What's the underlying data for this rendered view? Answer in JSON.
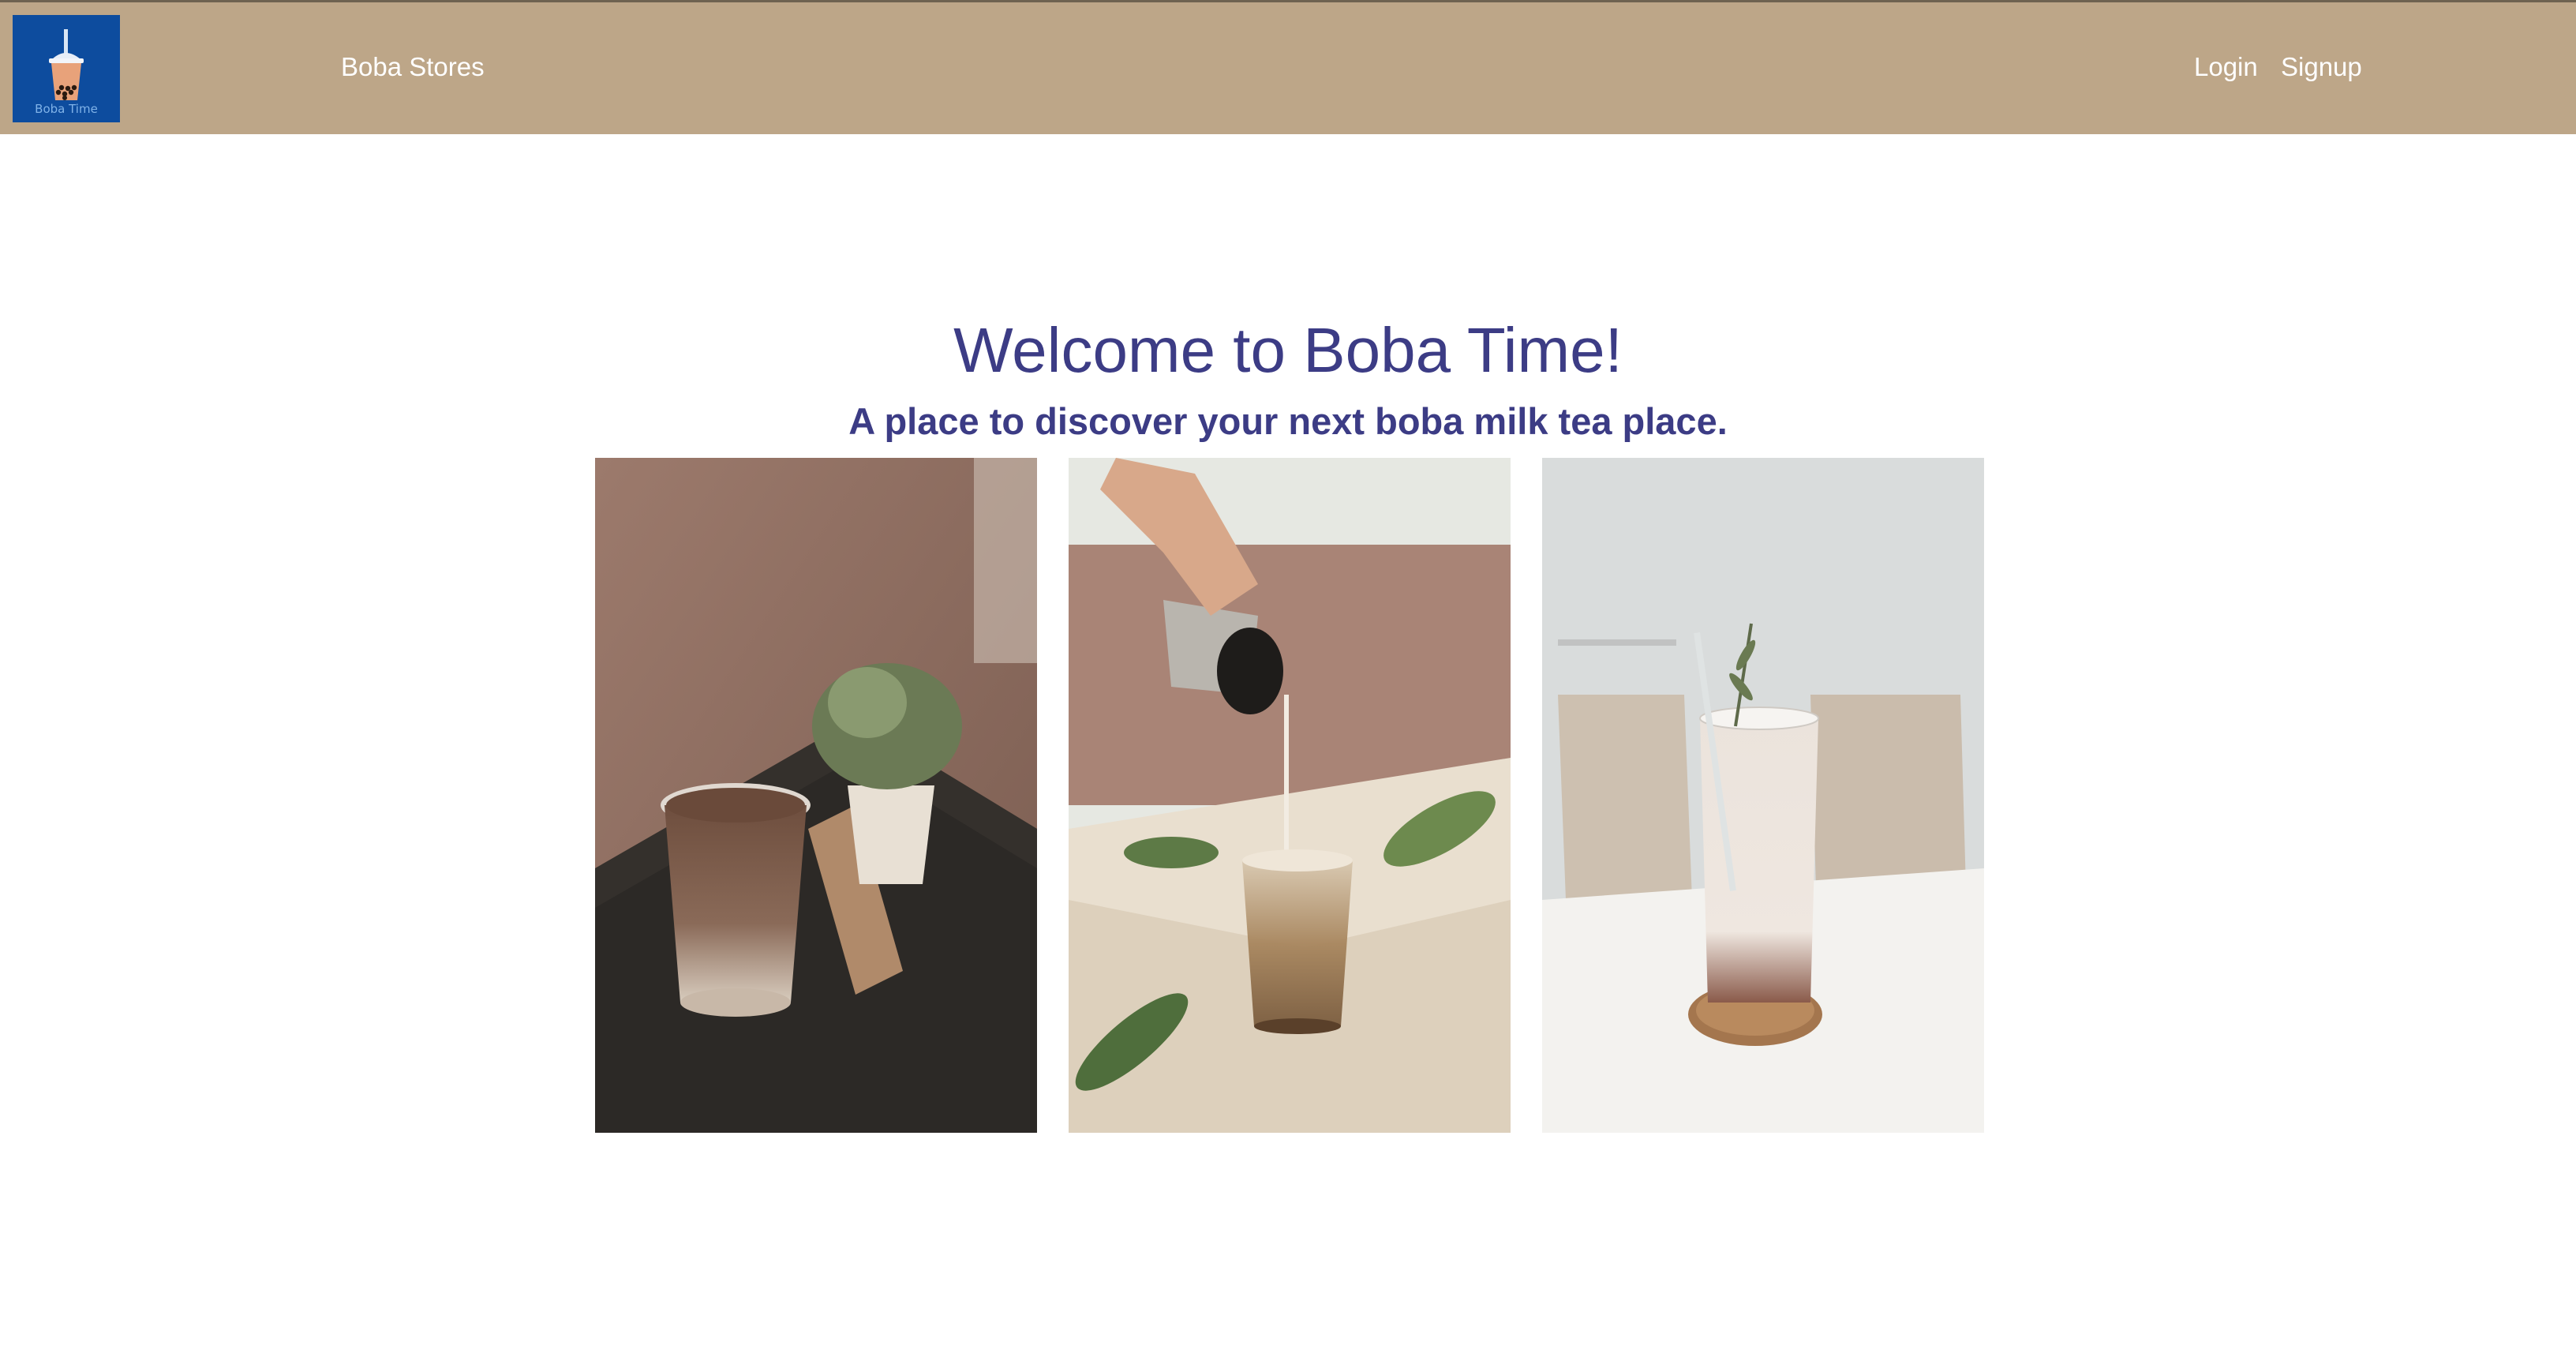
{
  "navbar": {
    "logo": {
      "text": "Boba Time",
      "icon": "boba-cup-icon",
      "background_color": "#0d4c9e"
    },
    "links": {
      "stores": "Boba Stores",
      "login": "Login",
      "signup": "Signup"
    },
    "background_color": "#bda688"
  },
  "hero": {
    "title": "Welcome to Boba Time!",
    "subtitle": "A place to discover your next boba milk tea place.",
    "text_color": "#3c3c85"
  },
  "gallery": {
    "images": [
      {
        "name": "iced-coffee-with-plant-photo"
      },
      {
        "name": "pouring-milk-into-boba-tea-photo"
      },
      {
        "name": "milk-tea-glass-on-coaster-photo"
      }
    ]
  }
}
